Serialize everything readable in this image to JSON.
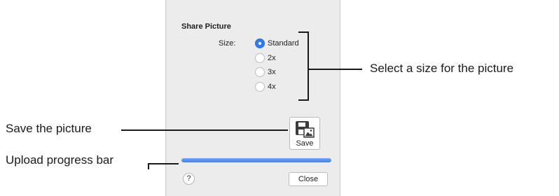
{
  "dialog": {
    "title": "Share Picture",
    "size_label": "Size:",
    "sizes": [
      {
        "label": "Standard",
        "selected": true
      },
      {
        "label": "2x",
        "selected": false
      },
      {
        "label": "3x",
        "selected": false
      },
      {
        "label": "4x",
        "selected": false
      }
    ],
    "save_label": "Save",
    "progress_fraction": 1.0,
    "help_label": "?",
    "close_label": "Close"
  },
  "annotations": {
    "size_callout": "Select a size for the picture",
    "save_callout": "Save the picture",
    "progress_callout": "Upload progress bar"
  },
  "colors": {
    "accent": "#2f7bef",
    "dialog_bg": "#ececec"
  }
}
